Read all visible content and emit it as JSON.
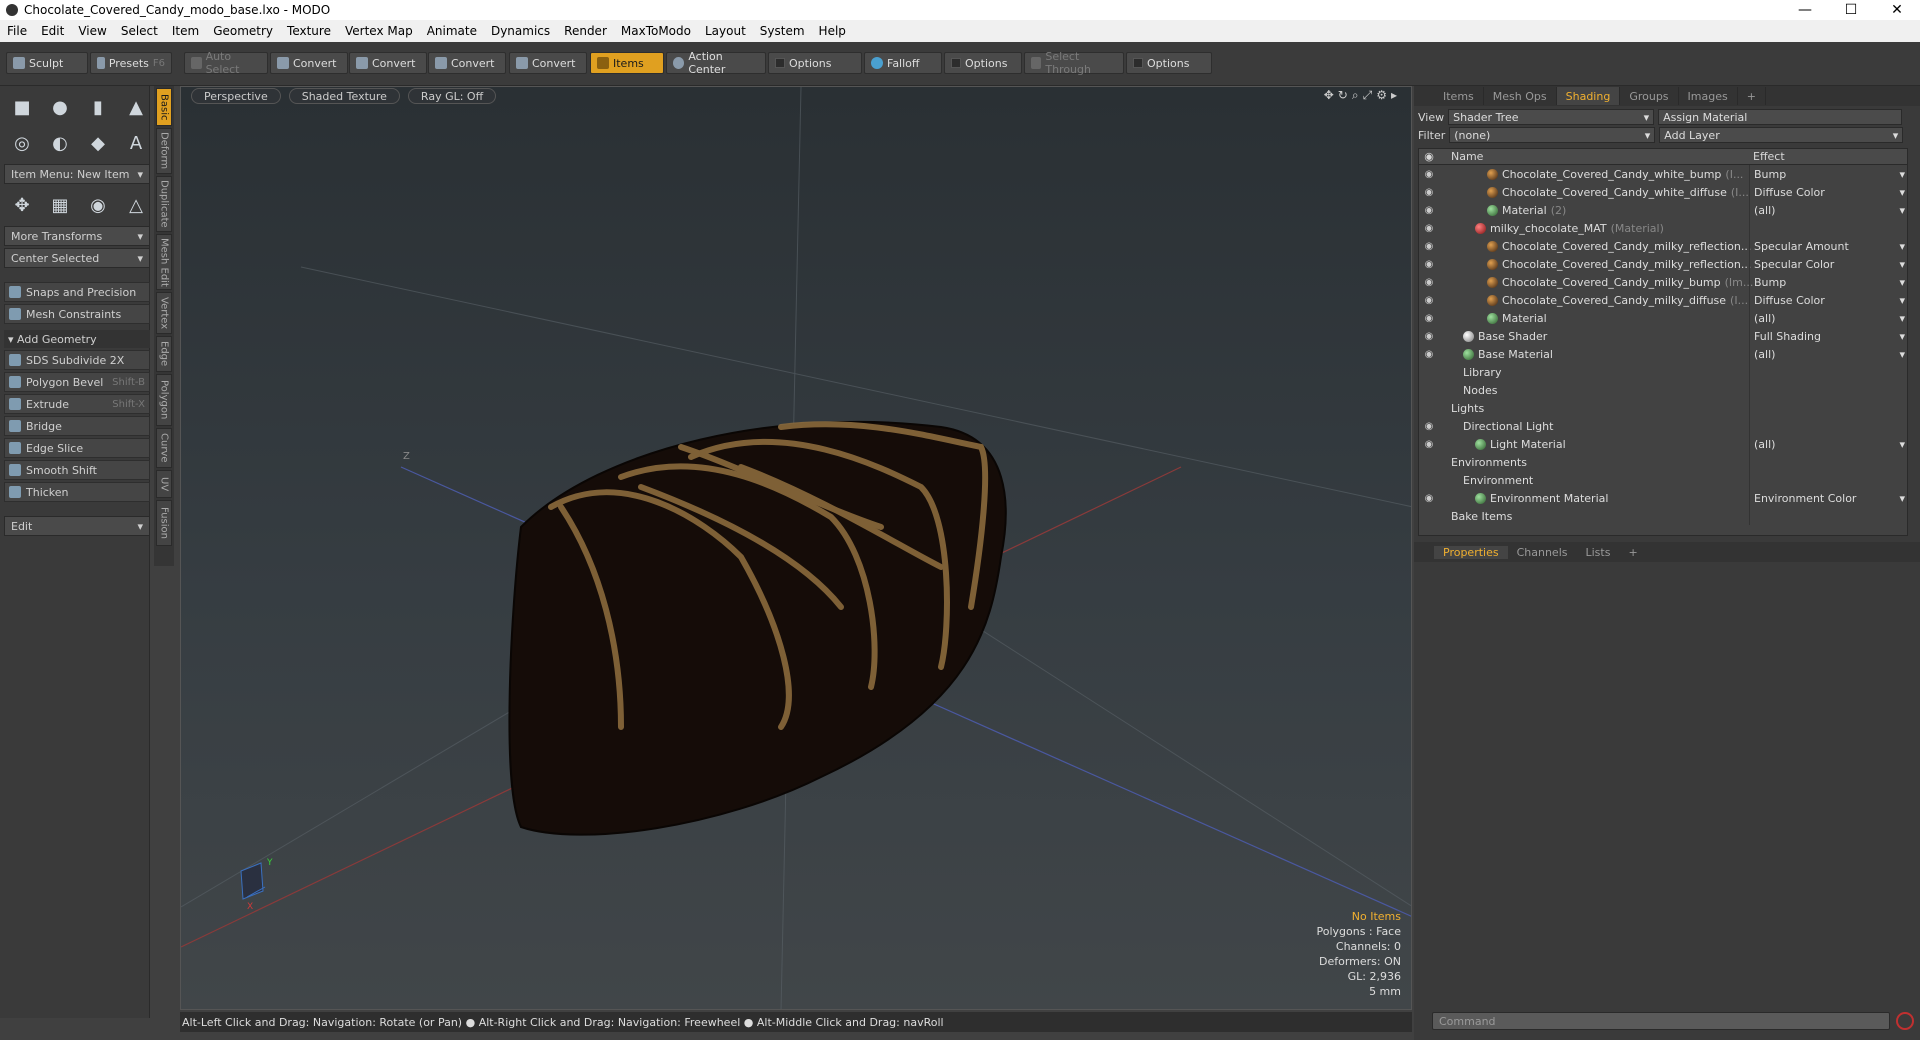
{
  "window": {
    "title": "Chocolate_Covered_Candy_modo_base.lxo - MODO",
    "controls": [
      "—",
      "☐",
      "✕"
    ]
  },
  "menu": [
    "File",
    "Edit",
    "View",
    "Select",
    "Item",
    "Geometry",
    "Texture",
    "Vertex Map",
    "Animate",
    "Dynamics",
    "Render",
    "MaxToModo",
    "Layout",
    "System",
    "Help"
  ],
  "toolbar": {
    "sculpt": "Sculpt",
    "presets": "Presets",
    "presets_shortcut": "F6",
    "auto_select": "Auto Select",
    "convert1": "Convert",
    "convert2": "Convert",
    "convert3": "Convert",
    "convert4": "Convert",
    "items": "Items",
    "action_center": "Action Center",
    "options1": "Options",
    "falloff": "Falloff",
    "options2": "Options",
    "select_through": "Select Through",
    "options3": "Options"
  },
  "left": {
    "item_menu": "Item Menu: New Item",
    "more_transforms": "More Transforms",
    "center_selected": "Center Selected",
    "snaps": "Snaps and Precision",
    "mesh_constraints": "Mesh Constraints",
    "add_geometry": "Add Geometry",
    "tools": [
      {
        "label": "SDS Subdivide 2X",
        "shortcut": ""
      },
      {
        "label": "Polygon Bevel",
        "shortcut": "Shift-B"
      },
      {
        "label": "Extrude",
        "shortcut": "Shift-X"
      },
      {
        "label": "Bridge",
        "shortcut": ""
      },
      {
        "label": "Edge Slice",
        "shortcut": ""
      },
      {
        "label": "Smooth Shift",
        "shortcut": ""
      },
      {
        "label": "Thicken",
        "shortcut": ""
      }
    ],
    "edit": "Edit",
    "vtabs": [
      "Basic",
      "Deform",
      "Duplicate",
      "Mesh Edit",
      "Vertex",
      "Edge",
      "Polygon",
      "Curve",
      "UV",
      "Fusion"
    ]
  },
  "viewport": {
    "view": "Perspective",
    "shading": "Shaded Texture",
    "raygl": "Ray GL: Off",
    "stats": {
      "no_items": "No Items",
      "polygons": "Polygons : Face",
      "channels": "Channels: 0",
      "deformers": "Deformers: ON",
      "gl": "GL: 2,936",
      "scale": "5 mm"
    },
    "axis_labels": {
      "y": "Y",
      "x": "X",
      "z": "Z"
    }
  },
  "status": "Alt-Left Click and Drag: Navigation: Rotate (or Pan) ● Alt-Right Click and Drag: Navigation: Freewheel ● Alt-Middle Click and Drag: navRoll",
  "right": {
    "tabs": [
      "Items",
      "Mesh Ops",
      "Shading",
      "Groups",
      "Images",
      "+"
    ],
    "view_label": "View",
    "view_value": "Shader Tree",
    "assign_material": "Assign Material",
    "filter_label": "Filter",
    "filter_value": "(none)",
    "add_layer": "Add Layer",
    "col_name": "Name",
    "col_effect": "Effect",
    "rows": [
      {
        "name": "Chocolate_Covered_Candy_white_bump",
        "sub": "(I...",
        "effect": "Bump",
        "type": "tex",
        "indent": 4,
        "eye": true
      },
      {
        "name": "Chocolate_Covered_Candy_white_diffuse",
        "sub": "(I...",
        "effect": "Diffuse Color",
        "type": "tex",
        "indent": 4,
        "eye": true
      },
      {
        "name": "Material",
        "sub": "(2)",
        "effect": "(all)",
        "type": "mat",
        "indent": 4,
        "eye": true
      },
      {
        "name": "milky_chocolate_MAT",
        "sub": "(Material)",
        "effect": "",
        "type": "red",
        "indent": 3,
        "eye": true
      },
      {
        "name": "Chocolate_Covered_Candy_milky_reflection...",
        "sub": "",
        "effect": "Specular Amount",
        "type": "tex",
        "indent": 4,
        "eye": true
      },
      {
        "name": "Chocolate_Covered_Candy_milky_reflection...",
        "sub": "",
        "effect": "Specular Color",
        "type": "tex",
        "indent": 4,
        "eye": true
      },
      {
        "name": "Chocolate_Covered_Candy_milky_bump",
        "sub": "(Im...",
        "effect": "Bump",
        "type": "tex",
        "indent": 4,
        "eye": true
      },
      {
        "name": "Chocolate_Covered_Candy_milky_diffuse",
        "sub": "(I...",
        "effect": "Diffuse Color",
        "type": "tex",
        "indent": 4,
        "eye": true
      },
      {
        "name": "Material",
        "sub": "",
        "effect": "(all)",
        "type": "mat",
        "indent": 4,
        "eye": true
      },
      {
        "name": "Base Shader",
        "sub": "",
        "effect": "Full Shading",
        "type": "grey",
        "indent": 2,
        "eye": true
      },
      {
        "name": "Base Material",
        "sub": "",
        "effect": "(all)",
        "type": "mat",
        "indent": 2,
        "eye": true
      },
      {
        "name": "Library",
        "sub": "",
        "effect": "",
        "type": "none",
        "indent": 2,
        "eye": false
      },
      {
        "name": "Nodes",
        "sub": "",
        "effect": "",
        "type": "none",
        "indent": 2,
        "eye": false
      },
      {
        "name": "Lights",
        "sub": "",
        "effect": "",
        "type": "none",
        "indent": 1,
        "eye": false
      },
      {
        "name": "Directional Light",
        "sub": "",
        "effect": "",
        "type": "none",
        "indent": 2,
        "eye": true
      },
      {
        "name": "Light Material",
        "sub": "",
        "effect": "(all)",
        "type": "mat",
        "indent": 3,
        "eye": true
      },
      {
        "name": "Environments",
        "sub": "",
        "effect": "",
        "type": "none",
        "indent": 1,
        "eye": false
      },
      {
        "name": "Environment",
        "sub": "",
        "effect": "",
        "type": "none",
        "indent": 2,
        "eye": false
      },
      {
        "name": "Environment Material",
        "sub": "",
        "effect": "Environment Color",
        "type": "mat",
        "indent": 3,
        "eye": true
      },
      {
        "name": "Bake Items",
        "sub": "",
        "effect": "",
        "type": "none",
        "indent": 1,
        "eye": false
      }
    ],
    "prop_tabs": [
      "Properties",
      "Channels",
      "Lists",
      "+"
    ],
    "command_placeholder": "Command"
  }
}
